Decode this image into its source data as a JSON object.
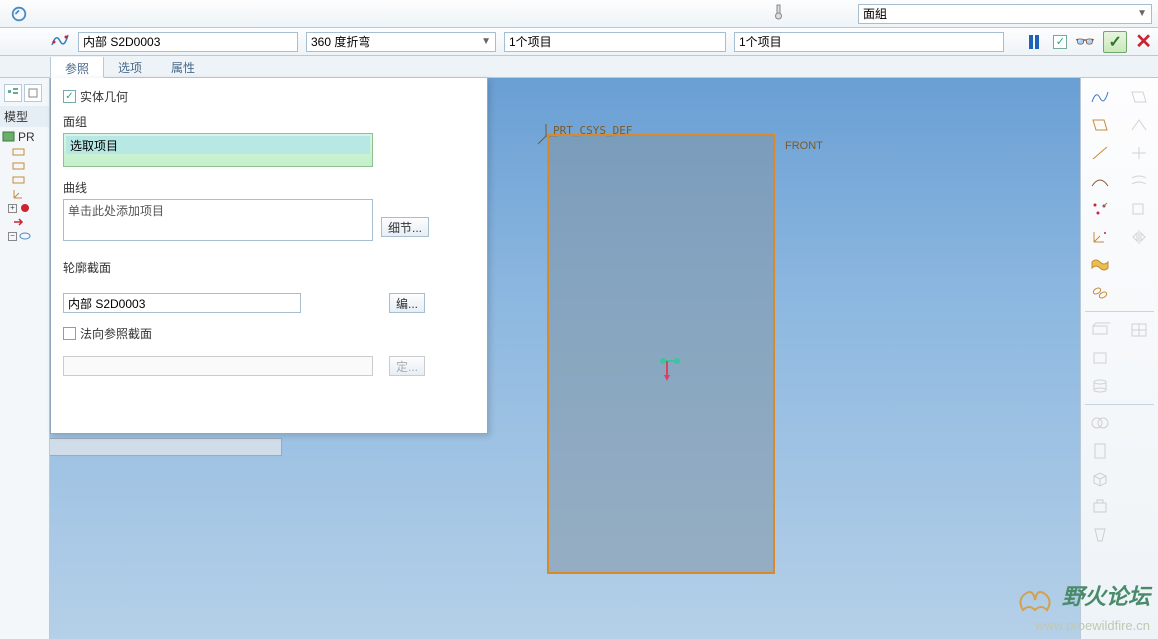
{
  "top": {
    "surface_group": "面組"
  },
  "toolbar": {
    "internal_ref": "内部 S2D0003",
    "bend": "360 度折弯",
    "items1": "1个项目",
    "items2": "1个项目"
  },
  "tabs": {
    "t1": "参照",
    "t2": "选项",
    "t3": "属性"
  },
  "left": {
    "model_label": "模型",
    "pr_item": "PR"
  },
  "panel": {
    "solid_geom": "实体几何",
    "surface_group": "面组",
    "select_item": "选取项目",
    "curve": "曲线",
    "click_add": "单击此处添加项目",
    "detail_btn": "细节...",
    "profile_section": "轮廓截面",
    "profile_value": "内部 S2D0003",
    "edit_btn": "编...",
    "normal_ref": "法向参照截面",
    "define_btn": "定..."
  },
  "viewport": {
    "csys": "PRT_CSYS_DEF",
    "front": "FRONT"
  },
  "watermark": {
    "line1": "野火论坛",
    "line2": "www.proewildfire.cn"
  }
}
